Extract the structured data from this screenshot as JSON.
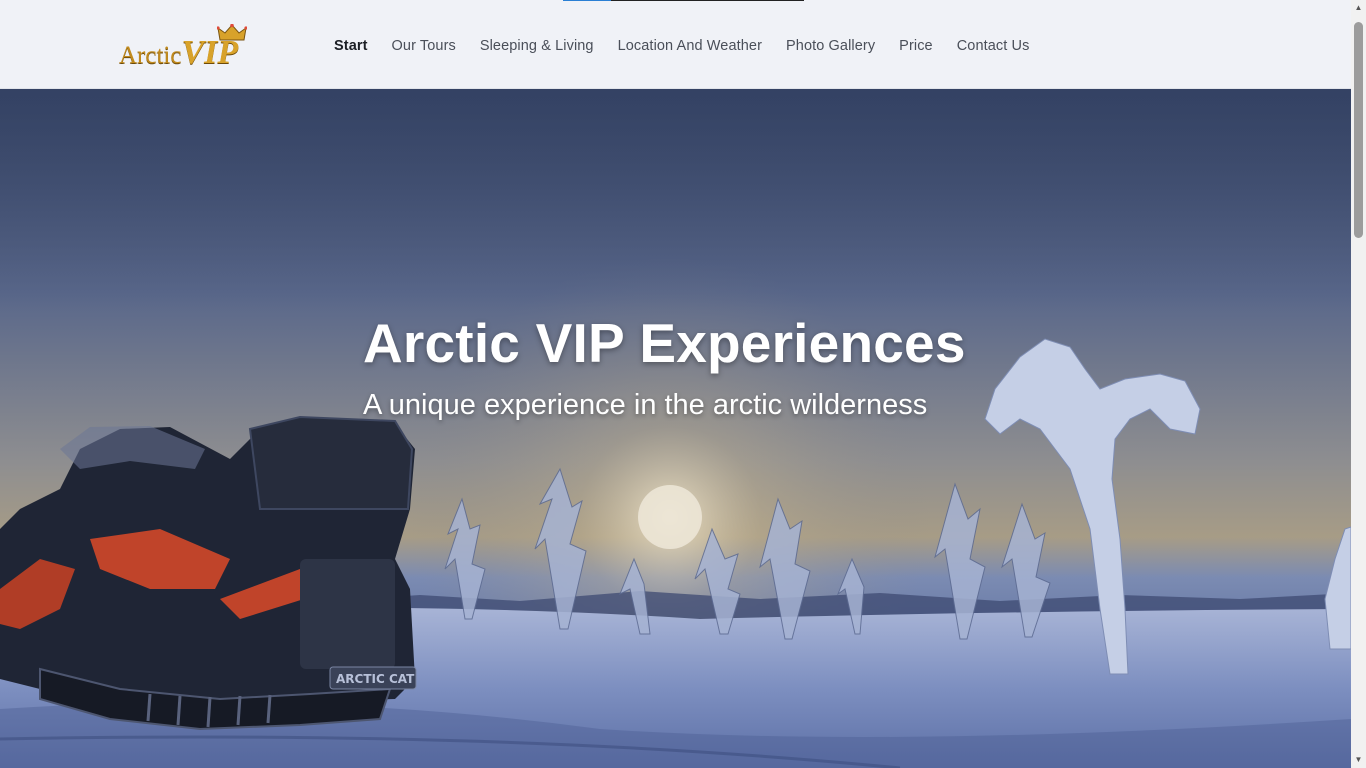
{
  "brand": {
    "logo_word1": "Arctic",
    "logo_word2": "VIP",
    "gold": "#c18a1d"
  },
  "loading": {
    "progress_fraction": 0.2
  },
  "nav": {
    "items": [
      {
        "label": "Start",
        "active": true
      },
      {
        "label": "Our Tours",
        "active": false
      },
      {
        "label": "Sleeping & Living",
        "active": false
      },
      {
        "label": "Location And Weather",
        "active": false
      },
      {
        "label": "Photo Gallery",
        "active": false
      },
      {
        "label": "Price",
        "active": false
      },
      {
        "label": "Contact Us",
        "active": false
      }
    ]
  },
  "hero": {
    "title": "Arctic VIP Experiences",
    "subtitle": "A unique experience in the arctic wilderness",
    "snowmobile_plate": "ARCTIC CAT"
  },
  "scrollbar": {
    "up_icon": "▲",
    "down_icon": "▼"
  }
}
